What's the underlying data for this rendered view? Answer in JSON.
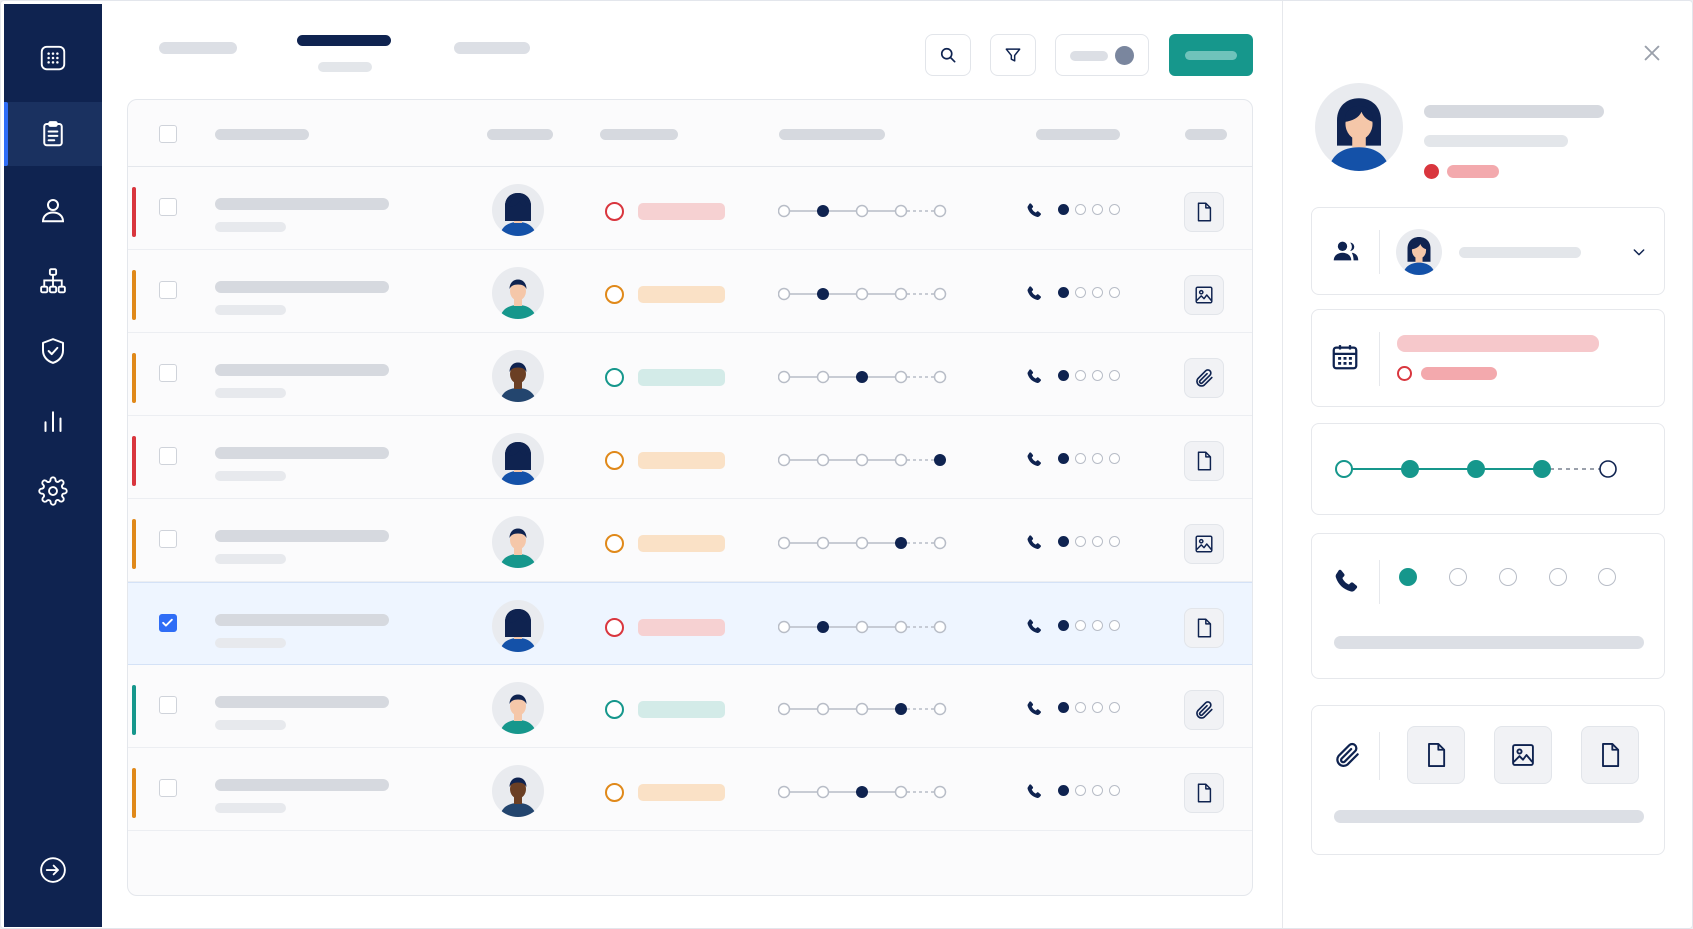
{
  "theme": {
    "navy": "#0f2350",
    "teal": "#16978c",
    "blue": "#2f6df6",
    "red": "#d9363e",
    "orange": "#e0891a",
    "green": "#16978c",
    "pill_red": "#f6d1d2",
    "pill_orange": "#fae1c6",
    "pill_green": "#d3ebe8"
  },
  "sidebar": {
    "items": [
      {
        "icon": "grid-icon",
        "active": false
      },
      {
        "icon": "clipboard-icon",
        "active": true
      },
      {
        "icon": "user-icon",
        "active": false
      },
      {
        "icon": "hierarchy-icon",
        "active": false
      },
      {
        "icon": "shield-check-icon",
        "active": false
      },
      {
        "icon": "bar-chart-icon",
        "active": false
      },
      {
        "icon": "gear-icon",
        "active": false
      }
    ],
    "bottom_icon": "logout-icon"
  },
  "toolbar": {
    "tabs_count": 3,
    "active_tab": 1,
    "buttons": [
      "search-icon",
      "filter-icon",
      "toggle-switch"
    ],
    "primary_button_label": ""
  },
  "table": {
    "rows": [
      {
        "accent": "red",
        "status": "red",
        "avatar": "female",
        "stage": 1,
        "dial": 0,
        "attachment": "document-icon",
        "checked": false
      },
      {
        "accent": "orange",
        "status": "orange",
        "avatar": "male",
        "stage": 1,
        "dial": 0,
        "attachment": "image-icon",
        "checked": false
      },
      {
        "accent": "orange",
        "status": "green",
        "avatar": "male-dark",
        "stage": 2,
        "dial": 0,
        "attachment": "paperclip-icon",
        "checked": false
      },
      {
        "accent": "red",
        "status": "orange",
        "avatar": "female",
        "stage": 4,
        "dial": 0,
        "attachment": "document-icon",
        "checked": false
      },
      {
        "accent": "orange",
        "status": "orange",
        "avatar": "male",
        "stage": 3,
        "dial": 0,
        "attachment": "image-icon",
        "checked": false
      },
      {
        "accent": "none",
        "status": "red",
        "avatar": "female",
        "stage": 1,
        "dial": 0,
        "attachment": "document-icon",
        "checked": true
      },
      {
        "accent": "green",
        "status": "green",
        "avatar": "male",
        "stage": 3,
        "dial": 0,
        "attachment": "paperclip-icon",
        "checked": false
      },
      {
        "accent": "orange",
        "status": "orange",
        "avatar": "male-dark",
        "stage": 2,
        "dial": 0,
        "attachment": "document-icon",
        "checked": false
      }
    ]
  },
  "detail": {
    "avatar": "female",
    "status": "red",
    "assignee_avatar": "female",
    "progress_filled": 4,
    "progress_total": 5,
    "call_attempts_done": 1,
    "call_attempts_total": 5,
    "attachments": [
      "document-icon",
      "image-icon",
      "document-icon"
    ]
  }
}
